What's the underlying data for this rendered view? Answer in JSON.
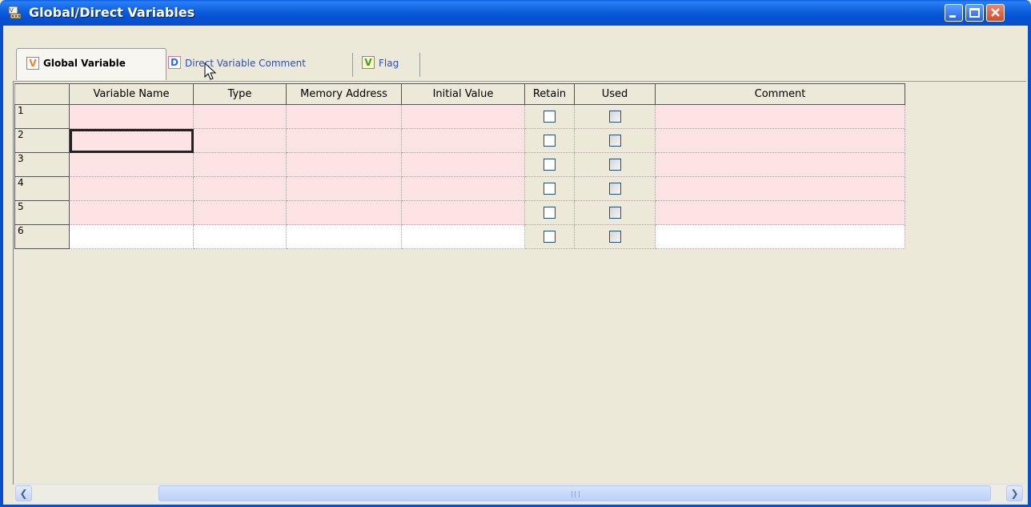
{
  "window": {
    "title": "Global/Direct Variables",
    "minimize_icon": "minimize-icon",
    "maximize_icon": "maximize-icon",
    "close_icon": "close-icon"
  },
  "tabs": [
    {
      "label": "Global Variable",
      "icon_letter": "V",
      "icon_color": "#f08030",
      "active": true
    },
    {
      "label": "Direct Variable Comment",
      "icon_letter": "D",
      "icon_color": "#3070d0",
      "active": false
    },
    {
      "label": "Flag",
      "icon_letter": "V",
      "icon_color": "#30a040",
      "active": false
    }
  ],
  "grid": {
    "columns": [
      "Variable Name",
      "Type",
      "Memory Address",
      "Initial Value",
      "Retain",
      "Used",
      "Comment"
    ],
    "rows": [
      {
        "num": "1",
        "retain": false,
        "used": false
      },
      {
        "num": "2",
        "retain": false,
        "used": false
      },
      {
        "num": "3",
        "retain": false,
        "used": false
      },
      {
        "num": "4",
        "retain": false,
        "used": false
      },
      {
        "num": "5",
        "retain": false,
        "used": false
      },
      {
        "num": "6",
        "retain": false,
        "used": false
      }
    ],
    "row_color_defined": "#fde3e3",
    "row_color_new": "#ffffff"
  },
  "scrollbar": {
    "left_icon": "arrow-left-icon",
    "right_icon": "arrow-right-icon"
  }
}
